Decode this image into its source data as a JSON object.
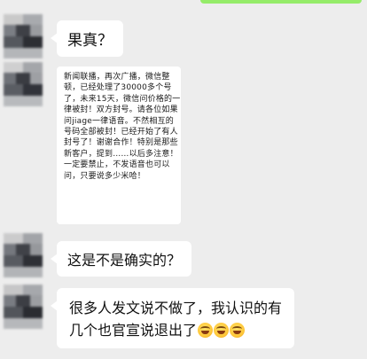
{
  "messages": [
    {
      "type": "text",
      "text": "果真？"
    },
    {
      "type": "image",
      "text": "新闻联播，再次广播，微信整顿，已经处理了30000多个号了，未来15天，微信问价格的一律被封！双方封号。请各位如果问jiage一律语音。不然相互的号码全部被封！已经开始了有人封号了！谢谢合作！特别是那些新客户，提到……以后多注意！一定要禁止，不发语音也可以问，只要说多少米哈！"
    },
    {
      "type": "text",
      "text": "这是不是确实的？"
    },
    {
      "type": "text",
      "text": "很多人发文说不做了，我认识的有几个也官宣说退出了",
      "emoji": [
        "laughing-crying-emoji",
        "laughing-crying-emoji",
        "laughing-crying-emoji"
      ]
    }
  ],
  "colors": {
    "background": "#ededed",
    "bubble": "#ffffff",
    "self_bubble": "#95ec69"
  }
}
